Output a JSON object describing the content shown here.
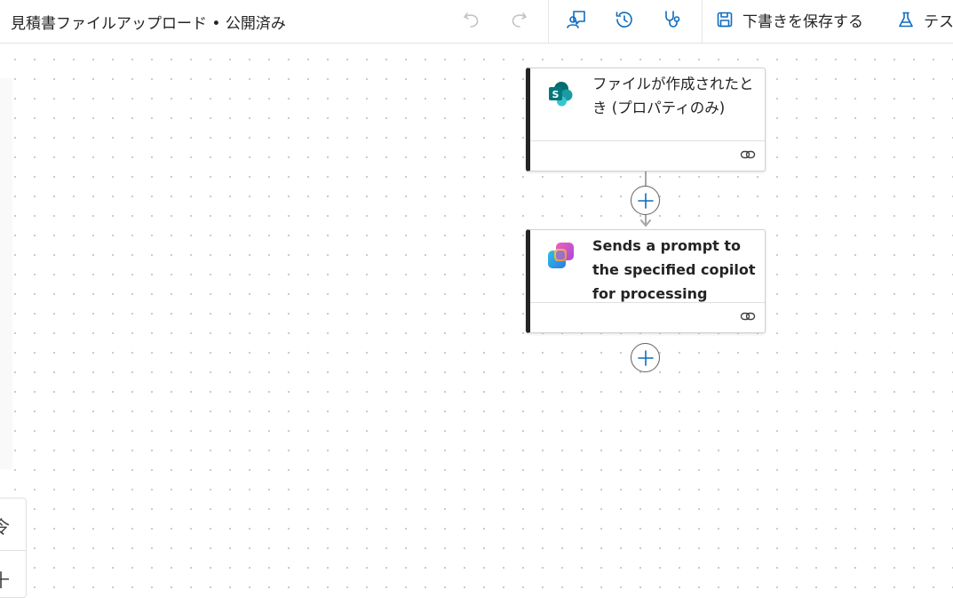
{
  "header": {
    "title": "見積書ファイルアップロード • 公開済み",
    "save_draft_label": "下書きを保存する",
    "test_label": "テスト"
  },
  "icons": {
    "undo": "undo-icon",
    "redo": "redo-icon",
    "copilot_chat": "copilot-chat-icon",
    "version_history": "history-icon",
    "flow_checker": "stethoscope-icon",
    "save": "save-icon",
    "test": "flask-icon",
    "trigger": "sharepoint-icon",
    "action": "copilot-studio-icon",
    "link": "link-icon",
    "add": "plus-icon"
  },
  "colors": {
    "accent": "#0f6cbd",
    "disabled": "#c4c4c4",
    "card_border": "#242424",
    "sharepoint": "#03787c"
  },
  "nodes": [
    {
      "title": "ファイルが作成されたとき (プロパティのみ)"
    },
    {
      "title": "Sends a prompt to the specified copilot for processing"
    }
  ],
  "zoom": {
    "top_glyph": "令",
    "bottom_glyph": "十"
  }
}
